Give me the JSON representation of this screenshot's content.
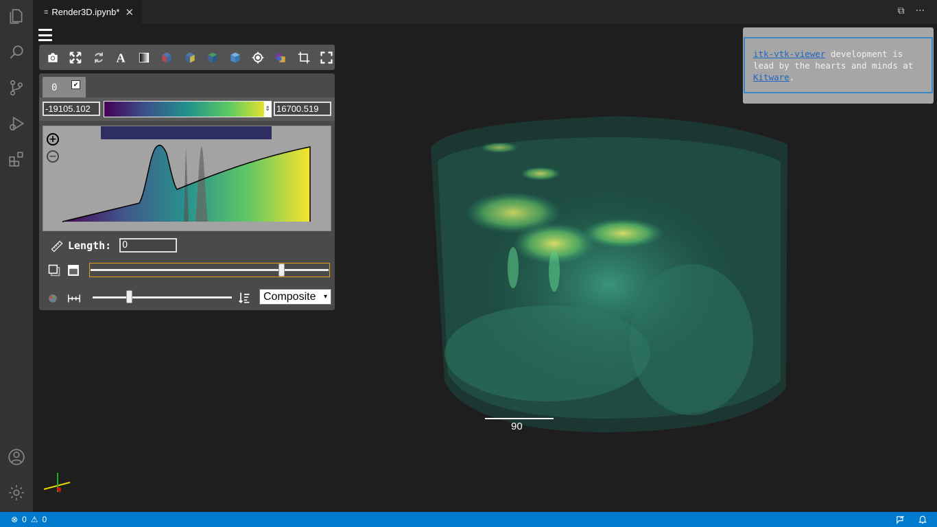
{
  "activity_bar": {
    "icons": [
      "explorer-icon",
      "search-icon",
      "source-control-icon",
      "run-debug-icon",
      "extensions-icon",
      "account-icon",
      "settings-gear-icon"
    ]
  },
  "tab": {
    "title": "Render3D.ipynb*",
    "close_glyph": "✕"
  },
  "tab_actions": {
    "split_glyph": "⧉",
    "more_glyph": "···"
  },
  "viewer": {
    "toolbar_icons": [
      "camera-icon",
      "fullscreen-expand-icon",
      "rotate-icon",
      "annotations-icon",
      "background-color-icon",
      "view-x-icon",
      "view-y-icon",
      "view-z-icon",
      "view-3d-icon",
      "interpolation-icon",
      "color-cube-icon",
      "crop-icon",
      "maximize-icon"
    ],
    "component_tab": "0",
    "component_checked": "✔",
    "range_min": "-19105.102",
    "range_max": "16700.519",
    "colormap": "Viridis",
    "colormap_colors": [
      "#440154",
      "#3b528b",
      "#21918c",
      "#5ec962",
      "#fde725"
    ],
    "zoom_in": "+",
    "zoom_out": "−",
    "length_label": "Length:",
    "length_value": "0",
    "gradient_opacity": 0.81,
    "sample_distance": 0.25,
    "blend_mode": "Composite",
    "blend_arrow": "▾",
    "scale_value": "90"
  },
  "info": {
    "link1": "itk-vtk-viewer",
    "text": " development is lead by the hearts and minds at ",
    "link2": "Kitware",
    "end": "."
  },
  "status": {
    "errors": "0",
    "warnings": "0"
  }
}
